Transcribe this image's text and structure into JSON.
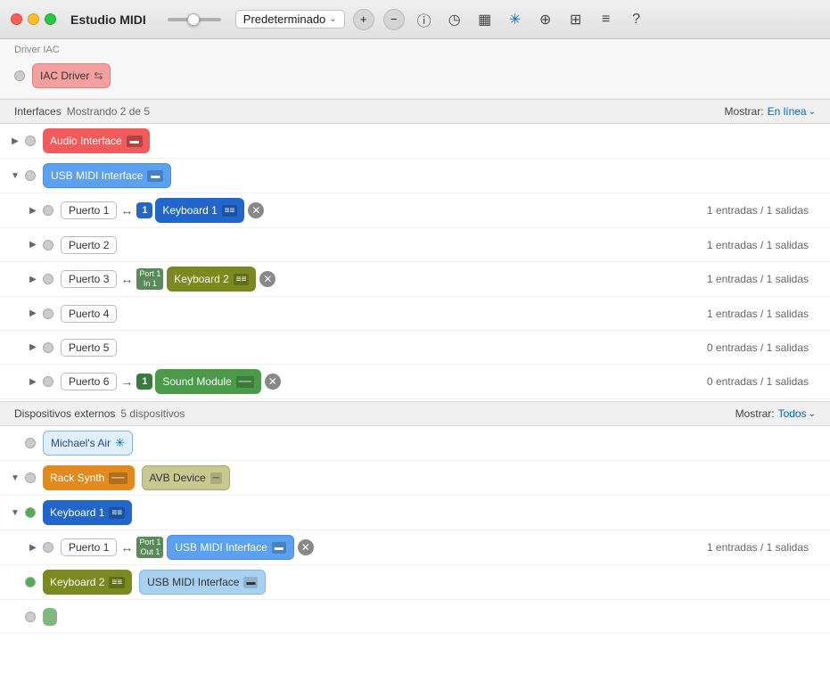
{
  "titlebar": {
    "title": "Estudio MIDI",
    "preset_label": "Predeterminado",
    "tl_close": "×",
    "tl_min": "−",
    "tl_max": "+"
  },
  "toolbar": {
    "add_label": "+",
    "remove_label": "−"
  },
  "iac_section": {
    "label": "Driver IAC",
    "driver_name": "IAC Driver"
  },
  "interfaces_section": {
    "label": "Interfaces",
    "count": "Mostrando 2 de 5",
    "show_label": "Mostrar:",
    "show_value": "En línea",
    "devices": [
      {
        "name": "Audio Interface",
        "color": "chip-red",
        "expanded": false,
        "type": "audio"
      },
      {
        "name": "USB MIDI Interface",
        "color": "chip-blue",
        "expanded": true,
        "type": "usb"
      }
    ],
    "ports": [
      {
        "name": "Puerto 1",
        "arrow": "↔",
        "device_badge": "1",
        "device_name": "Keyboard 1",
        "device_color": "chip-keyboard1",
        "has_remove": true,
        "io": "1 entradas / 1 salidas"
      },
      {
        "name": "Puerto 2",
        "arrow": "",
        "device_badge": "",
        "device_name": "",
        "device_color": "",
        "has_remove": false,
        "io": "1 entradas / 1 salidas"
      },
      {
        "name": "Puerto 3",
        "arrow": "↔",
        "port_badge": "Port 1\nIn 1",
        "device_name": "Keyboard 2",
        "device_color": "chip-keyboard2",
        "has_remove": true,
        "io": "1 entradas / 1 salidas"
      },
      {
        "name": "Puerto 4",
        "arrow": "",
        "device_badge": "",
        "device_name": "",
        "device_color": "",
        "has_remove": false,
        "io": "1 entradas / 1 salidas"
      },
      {
        "name": "Puerto 5",
        "arrow": "",
        "device_badge": "",
        "device_name": "",
        "device_color": "",
        "has_remove": false,
        "io": "0 entradas / 1 salidas"
      },
      {
        "name": "Puerto 6",
        "arrow": "→",
        "device_badge": "1",
        "device_name": "Sound Module",
        "device_color": "chip-green",
        "has_remove": true,
        "io": "0 entradas / 1 salidas"
      }
    ]
  },
  "external_section": {
    "label": "Dispositivos externos",
    "count": "5 dispositivos",
    "show_label": "Mostrar:",
    "show_value": "Todos",
    "devices": [
      {
        "name": "Michael's Air",
        "color": "chip-blue-outline",
        "has_bluetooth": true,
        "expanded": false
      },
      {
        "name": "Rack Synth",
        "color": "chip-orange",
        "has_bluetooth": false,
        "sibling": "AVB Device",
        "sibling_color": "chip-light-green",
        "expanded": true
      },
      {
        "name": "Keyboard 1",
        "color": "chip-keyboard1",
        "has_bluetooth": false,
        "expanded": true
      }
    ],
    "keyboard1_ports": [
      {
        "name": "Puerto 1",
        "arrow": "↔",
        "port_badge": "Port 1\nOut 1",
        "device_name": "USB MIDI Interface",
        "device_color": "chip-blue",
        "has_remove": true,
        "io": "1 entradas / 1 salidas"
      }
    ],
    "keyboard2_row": {
      "name": "Keyboard 2",
      "color": "chip-keyboard2",
      "sibling": "USB MIDI Interface",
      "sibling_color": "chip-blue"
    }
  },
  "icons": {
    "chevron_right": "▶",
    "chevron_down": "▼",
    "expand": "▶",
    "collapse": "▼",
    "usb_icon": "▬",
    "bt": "⊛",
    "plus": "+",
    "minus": "−",
    "info": "ⓘ",
    "clock": "◷",
    "piano": "▦",
    "bluetooth": "✳",
    "network": "⊕",
    "grid": "⊞",
    "list": "≡",
    "help": "?",
    "close": "✕"
  }
}
